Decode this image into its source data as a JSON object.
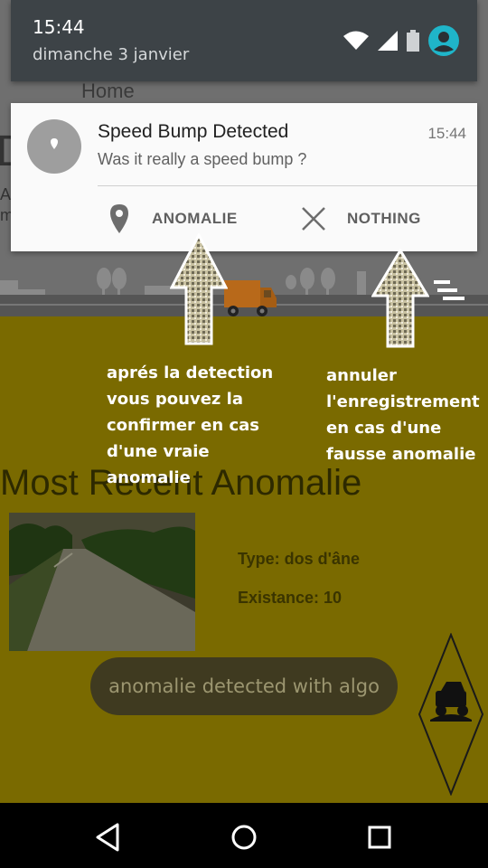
{
  "status_shade": {
    "time": "15:44",
    "date": "dimanche 3 janvier",
    "icons": [
      "wifi-icon",
      "signal-icon",
      "battery-icon",
      "account-icon"
    ]
  },
  "notification": {
    "title": "Speed Bump Detected",
    "time": "15:44",
    "text": "Was it really a speed bump ?",
    "actions": [
      {
        "label": "ANOMALIE",
        "icon": "location-pin-icon"
      },
      {
        "label": "NOTHING",
        "icon": "close-icon"
      }
    ]
  },
  "annotations": {
    "left": "aprés la detection vous pouvez la confirmer en cas d'une vraie anomalie",
    "right": "annuler l'enregistrement en cas d'une fausse anomalie"
  },
  "app": {
    "home_label": "Home",
    "section_title": "Most Recent Anomalie",
    "type_text": "Type: dos d'âne",
    "existance_text": "Existance: 10",
    "toast": "anomalie detected with algo"
  },
  "colors": {
    "app_background": "#7a6a00",
    "shade_background": "#3d4347",
    "account_accent": "#1fb5c9",
    "notification_background": "#fafafa"
  }
}
